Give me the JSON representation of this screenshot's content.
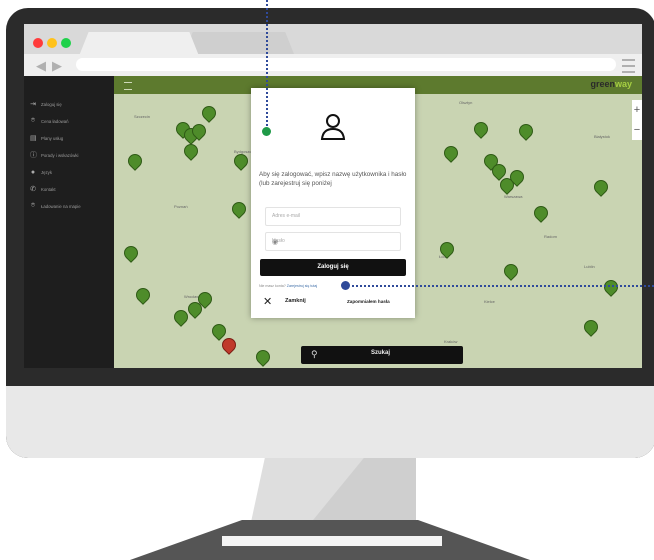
{
  "brand": {
    "prefix": "green",
    "suffix": "way",
    "accent": "#a6cf42",
    "bar_color": "#5d7a2e"
  },
  "sidebar": {
    "items": [
      {
        "label": "Zaloguj się",
        "icon": "login-icon"
      },
      {
        "label": "Cena ładowań",
        "icon": "location-icon"
      },
      {
        "label": "Plany usług",
        "icon": "document-icon"
      },
      {
        "label": "Porady i wskazówki",
        "icon": "info-icon"
      },
      {
        "label": "Język",
        "icon": "globe-icon"
      },
      {
        "label": "Kontakt",
        "icon": "phone-icon"
      },
      {
        "label": "Ładowanie na mapie",
        "icon": "pin-icon"
      }
    ]
  },
  "map": {
    "search_label": "Szukaj",
    "labels": [
      "Szczecin",
      "Bydgoszcz",
      "Poznań",
      "Łódź",
      "Warszawa",
      "Lublin",
      "Wrocław",
      "Kraków",
      "Kielce",
      "Radom",
      "Olsztyn",
      "Białystok"
    ]
  },
  "modal": {
    "prompt": "Aby się zalogować, wpisz nazwę użytkownika i hasło (lub zarejestruj się poniżej",
    "email_placeholder": "Adres e-mail",
    "password_placeholder": "Hasło",
    "login_button": "Zaloguj się",
    "register_prefix": "Nie masz konta?",
    "register_link": "Zarejestruj się tutaj",
    "close_label": "Zamknij",
    "forgot_password": "Zapomniałem hasła"
  }
}
